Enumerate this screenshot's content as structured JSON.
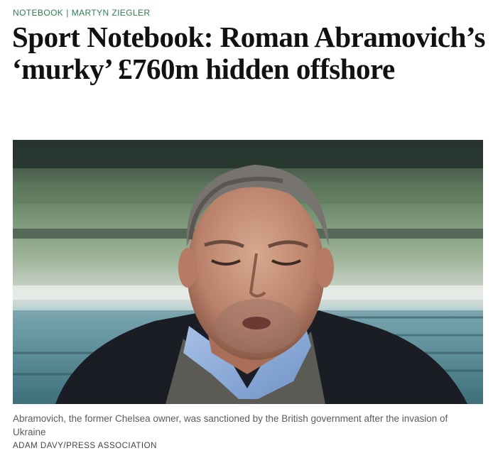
{
  "kicker": {
    "section": "NOTEBOOK",
    "separator": "|",
    "author": "MARTYN ZIEGLER"
  },
  "headline": "Sport Notebook: Roman Abramovich’s ‘murky’ £760m hidden offshore",
  "photo": {
    "subject": "Roman Abramovich"
  },
  "caption": "Abramovich, the former Chelsea owner, was sanctioned by the British government after the invasion of Ukraine",
  "credit": "ADAM DAVY/PRESS ASSOCIATION"
}
